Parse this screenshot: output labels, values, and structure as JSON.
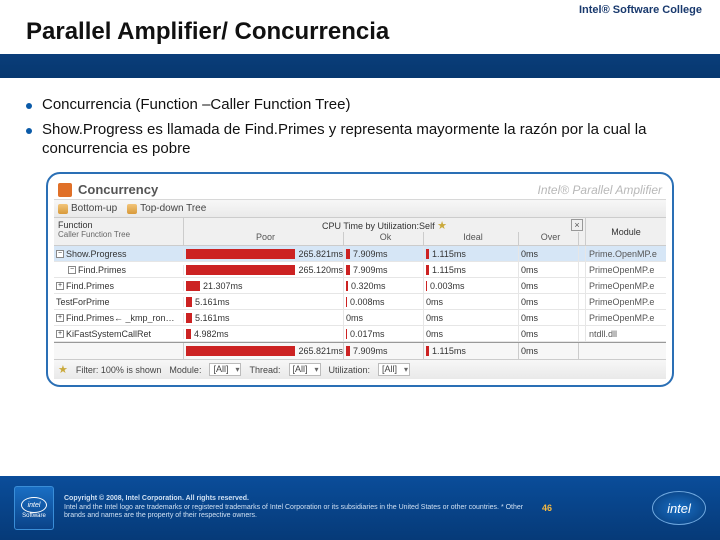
{
  "header": {
    "college": "Intel® Software College",
    "title": "Parallel Amplifier/ Concurrencia"
  },
  "bullets": [
    "Concurrencia (Function –Caller Function Tree)",
    "Show.Progress es llamada de Find.Primes y representa mayormente la razón por la cual la concurrencia es pobre"
  ],
  "screenshot": {
    "title": "Concurrency",
    "brand": "Intel® Parallel Amplifier",
    "tabs": {
      "bottomup": "Bottom-up",
      "topdown": "Top-down Tree"
    },
    "columns": {
      "function": "Function",
      "func_sub": "Caller Function Tree",
      "cpu": "CPU Time by Utilization:Self",
      "cpu_sub": [
        "Poor",
        "Ok",
        "Ideal",
        "Over"
      ],
      "module": "Module"
    },
    "col_widths": {
      "poor": 160,
      "ok": 80,
      "ideal": 95,
      "over": 60
    },
    "rows": [
      {
        "fn": "Show.Progress",
        "sel": true,
        "tree": "−",
        "indent": 0,
        "poor": "265.821ms",
        "poor_bar": 120,
        "ok": "7.909ms",
        "ok_bar": 4,
        "ideal": "1.115ms",
        "ideal_bar": 3,
        "over": "0ms",
        "mod": "Prime.OpenMP.e"
      },
      {
        "fn": "Find.Primes",
        "tree": "−",
        "indent": 1,
        "poor": "265.120ms",
        "poor_bar": 119,
        "ok": "7.909ms",
        "ok_bar": 4,
        "ideal": "1.115ms",
        "ideal_bar": 3,
        "over": "0ms",
        "mod": "PrimeOpenMP.e"
      },
      {
        "fn": "Find.Primes",
        "tree": "+",
        "indent": 0,
        "poor": "21.307ms",
        "poor_bar": 14,
        "ok": "0.320ms",
        "ok_bar": 2,
        "ideal": "0.003ms",
        "ideal_bar": 1,
        "over": "0ms",
        "mod": "PrimeOpenMP.e"
      },
      {
        "fn": "TestForPrime",
        "tree": "",
        "indent": 0,
        "poor": "5.161ms",
        "poor_bar": 6,
        "ok": "0.008ms",
        "ok_bar": 1,
        "ideal": "0ms",
        "ideal_bar": 0,
        "over": "0ms",
        "mod": "PrimeOpenMP.e"
      },
      {
        "fn": "Find.Primes← _kmp_ron…",
        "tree": "+",
        "indent": 0,
        "poor": "5.161ms",
        "poor_bar": 6,
        "ok": "0ms",
        "ok_bar": 0,
        "ideal": "0ms",
        "ideal_bar": 0,
        "over": "0ms",
        "mod": "PrimeOpenMP.e"
      },
      {
        "fn": "KiFastSystemCallRet",
        "tree": "+",
        "indent": 0,
        "poor": "4.982ms",
        "poor_bar": 5,
        "ok": "0.017ms",
        "ok_bar": 1,
        "ideal": "0ms",
        "ideal_bar": 0,
        "over": "0ms",
        "mod": "ntdll.dll"
      }
    ],
    "summary": {
      "poor": "265.821ms",
      "ok": "7.909ms",
      "ideal": "1.115ms",
      "over": "0ms"
    },
    "filter": {
      "filter_label": "Filter: 100% is shown",
      "module_label": "Module:",
      "module_val": "[All]",
      "thread_label": "Thread:",
      "thread_val": "[All]",
      "util_label": "Utilization:",
      "util_val": "[All]"
    }
  },
  "footer": {
    "badge_top": "intel",
    "badge_bottom": "Software",
    "copyright": "Copyright © 2008, Intel Corporation. All rights reserved.",
    "legal": "Intel and the Intel logo are trademarks or registered trademarks of Intel Corporation or its subsidiaries in the United States or other countries. * Other brands and names are the property of their respective owners.",
    "page": "46",
    "logo": "intel"
  }
}
